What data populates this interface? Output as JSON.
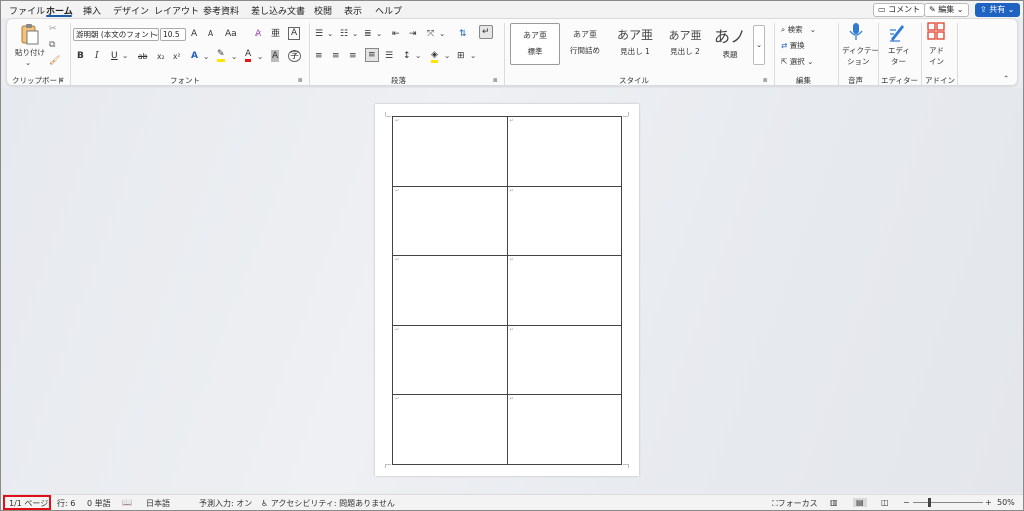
{
  "menu": {
    "tabs": [
      "ファイル",
      "ホーム",
      "挿入",
      "デザイン",
      "レイアウト",
      "参考資料",
      "差し込み文書",
      "校閲",
      "表示",
      "ヘルプ"
    ],
    "active_tab": "ホーム",
    "comment_label": "コメント",
    "edit_label": "編集",
    "share_label": "共有"
  },
  "ribbon": {
    "clipboard": {
      "paste_label": "貼り付け",
      "group_label": "クリップボード"
    },
    "font": {
      "font_name": "游明朝 (本文のフォント",
      "font_size": "10.5",
      "grow": "A",
      "shrink": "A",
      "case": "Aa",
      "bold": "B",
      "italic": "I",
      "underline": "U",
      "strike": "ab",
      "subscript": "x₂",
      "superscript": "x²",
      "group_label": "フォント"
    },
    "paragraph": {
      "group_label": "段落"
    },
    "styles": {
      "items": [
        {
          "sample": "あア亜",
          "name": "標準"
        },
        {
          "sample": "あア亜",
          "name": "行間詰め"
        },
        {
          "sample": "あア亜",
          "name": "見出し 1"
        },
        {
          "sample": "あア亜",
          "name": "見出し 2"
        },
        {
          "sample": "あノ",
          "name": "表題"
        }
      ],
      "group_label": "スタイル"
    },
    "editing": {
      "find": "検索",
      "replace": "置換",
      "select": "選択",
      "group_label": "編集"
    },
    "voice": {
      "dictate_line1": "ディクテー",
      "dictate_line2": "ション",
      "group_label": "音声"
    },
    "editor": {
      "line1": "エディ",
      "line2": "ター",
      "group_label": "エディター"
    },
    "addins": {
      "line1": "アド",
      "line2": "イン",
      "group_label": "アドイン"
    }
  },
  "status": {
    "page": "1/1 ページ",
    "line": "行: 6",
    "words": "0 単語",
    "language": "日本語",
    "predictive": "予測入力: オン",
    "accessibility": "アクセシビリティ: 問題ありません",
    "focus": "フォーカス",
    "zoom": "50%"
  },
  "colors": {
    "accent": "#1e62c2",
    "highlight_box": "#e0101a",
    "font_color_bar": "#e8141b",
    "highlight_bar": "#ffe600"
  }
}
